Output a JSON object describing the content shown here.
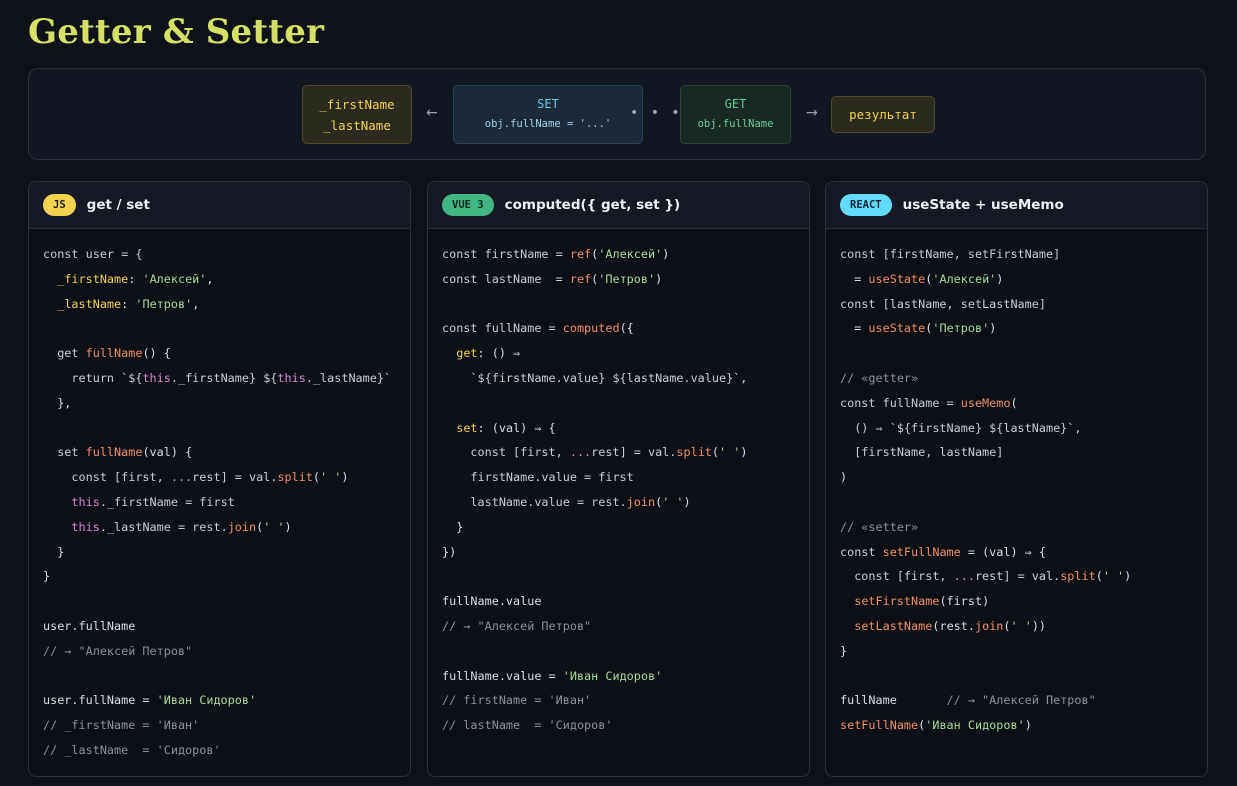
{
  "title": "Getter & Setter",
  "flow": {
    "fields_line1": "_firstName",
    "fields_line2": "_lastName",
    "arrow_left": "←",
    "set_label": "SET",
    "set_code": "obj.fullName = '...'",
    "dots": "• • •",
    "get_label": "GET",
    "get_code": "obj.fullName",
    "arrow_right": "→",
    "result_label": "результат"
  },
  "panels": [
    {
      "badge": "JS",
      "title": "get / set",
      "badge_bg": "#f2d24f",
      "badge_fg": "#1b1b10"
    },
    {
      "badge": "VUE 3",
      "title": "computed({ get, set })",
      "badge_bg": "#41b883",
      "badge_fg": "#0e2a1c"
    },
    {
      "badge": "REACT",
      "title": "useState + useMemo",
      "badge_bg": "#61dafb",
      "badge_fg": "#0b2530"
    }
  ],
  "code": {
    "js": [
      [
        [
          "const user = {",
          "kw"
        ]
      ],
      [
        [
          "  ",
          ""
        ],
        [
          "_firstName",
          "pr"
        ],
        [
          ": ",
          ""
        ],
        [
          "'Алексей'",
          "st"
        ],
        [
          ",",
          ""
        ]
      ],
      [
        [
          "  ",
          ""
        ],
        [
          "_lastName",
          "pr"
        ],
        [
          ": ",
          ""
        ],
        [
          "'Петров'",
          "st"
        ],
        [
          ",",
          ""
        ]
      ],
      [
        [
          "",
          ""
        ]
      ],
      [
        [
          "  get ",
          "kw"
        ],
        [
          "fullName",
          "fn"
        ],
        [
          "() {",
          ""
        ]
      ],
      [
        [
          "    return `${",
          "kw"
        ],
        [
          "this",
          "th"
        ],
        [
          "._firstName} ${",
          "kw"
        ],
        [
          "this",
          "th"
        ],
        [
          "._lastName}`",
          "kw"
        ]
      ],
      [
        [
          "  },",
          ""
        ]
      ],
      [
        [
          "",
          ""
        ]
      ],
      [
        [
          "  set ",
          "kw"
        ],
        [
          "fullName",
          "fn"
        ],
        [
          "(val) {",
          ""
        ]
      ],
      [
        [
          "    const [first, ",
          "kw"
        ],
        [
          "...",
          "th"
        ],
        [
          "rest] = val.",
          "kw"
        ],
        [
          "split",
          "fn"
        ],
        [
          "(",
          ""
        ],
        [
          "' '",
          "st"
        ],
        [
          ")",
          ""
        ]
      ],
      [
        [
          "    ",
          ""
        ],
        [
          "this",
          "th"
        ],
        [
          "._firstName = first",
          "kw"
        ]
      ],
      [
        [
          "    ",
          ""
        ],
        [
          "this",
          "th"
        ],
        [
          "._lastName = rest.",
          "kw"
        ],
        [
          "join",
          "fn"
        ],
        [
          "(",
          ""
        ],
        [
          "' '",
          "st"
        ],
        [
          ")",
          ""
        ]
      ],
      [
        [
          "  }",
          ""
        ]
      ],
      [
        [
          "}",
          ""
        ]
      ],
      [
        [
          "",
          ""
        ]
      ],
      [
        [
          "user.fullName",
          ""
        ]
      ],
      [
        [
          "// → \"Алексей Петров\"",
          "cm"
        ]
      ],
      [
        [
          "",
          ""
        ]
      ],
      [
        [
          "user.fullName = ",
          ""
        ],
        [
          "'Иван Сидоров'",
          "st"
        ]
      ],
      [
        [
          "// _firstName = 'Иван'",
          "cm"
        ]
      ],
      [
        [
          "// _lastName  = 'Сидоров'",
          "cm"
        ]
      ]
    ],
    "vue": [
      [
        [
          "const firstName = ",
          "kw"
        ],
        [
          "ref",
          "fn"
        ],
        [
          "(",
          ""
        ],
        [
          "'Алексей'",
          "st"
        ],
        [
          ")",
          ""
        ]
      ],
      [
        [
          "const lastName  = ",
          "kw"
        ],
        [
          "ref",
          "fn"
        ],
        [
          "(",
          ""
        ],
        [
          "'Петров'",
          "st"
        ],
        [
          ")",
          ""
        ]
      ],
      [
        [
          "",
          ""
        ]
      ],
      [
        [
          "const fullName = ",
          "kw"
        ],
        [
          "computed",
          "fn"
        ],
        [
          "({",
          ""
        ]
      ],
      [
        [
          "  ",
          ""
        ],
        [
          "get",
          "pr"
        ],
        [
          ": () ⇒",
          ""
        ]
      ],
      [
        [
          "    `${firstName.value} ${lastName.value}`,",
          "kw"
        ]
      ],
      [
        [
          "",
          ""
        ]
      ],
      [
        [
          "  ",
          ""
        ],
        [
          "set",
          "pr"
        ],
        [
          ": (val) ⇒ {",
          ""
        ]
      ],
      [
        [
          "    const [first, ",
          "kw"
        ],
        [
          "...",
          "th"
        ],
        [
          "rest] = val.",
          "kw"
        ],
        [
          "split",
          "fn"
        ],
        [
          "(",
          ""
        ],
        [
          "' '",
          "st"
        ],
        [
          ")",
          ""
        ]
      ],
      [
        [
          "    firstName.value = first",
          "kw"
        ]
      ],
      [
        [
          "    lastName.value = rest.",
          "kw"
        ],
        [
          "join",
          "fn"
        ],
        [
          "(",
          ""
        ],
        [
          "' '",
          "st"
        ],
        [
          ")",
          ""
        ]
      ],
      [
        [
          "  }",
          ""
        ]
      ],
      [
        [
          "})",
          ""
        ]
      ],
      [
        [
          "",
          ""
        ]
      ],
      [
        [
          "fullName.value",
          ""
        ]
      ],
      [
        [
          "// → \"Алексей Петров\"",
          "cm"
        ]
      ],
      [
        [
          "",
          ""
        ]
      ],
      [
        [
          "fullName.value = ",
          ""
        ],
        [
          "'Иван Сидоров'",
          "st"
        ]
      ],
      [
        [
          "// firstName = 'Иван'",
          "cm"
        ]
      ],
      [
        [
          "// lastName  = 'Сидоров'",
          "cm"
        ]
      ]
    ],
    "react": [
      [
        [
          "const [firstName, setFirstName]",
          "kw"
        ]
      ],
      [
        [
          "  = ",
          ""
        ],
        [
          "useState",
          "fn"
        ],
        [
          "(",
          ""
        ],
        [
          "'Алексей'",
          "st"
        ],
        [
          ")",
          ""
        ]
      ],
      [
        [
          "const [lastName, setLastName]",
          "kw"
        ]
      ],
      [
        [
          "  = ",
          ""
        ],
        [
          "useState",
          "fn"
        ],
        [
          "(",
          ""
        ],
        [
          "'Петров'",
          "st"
        ],
        [
          ")",
          ""
        ]
      ],
      [
        [
          "",
          ""
        ]
      ],
      [
        [
          "// «getter»",
          "cm"
        ]
      ],
      [
        [
          "const fullName = ",
          "kw"
        ],
        [
          "useMemo",
          "fn"
        ],
        [
          "(",
          ""
        ]
      ],
      [
        [
          "  () ⇒ `${firstName} ${lastName}`,",
          "kw"
        ]
      ],
      [
        [
          "  [firstName, lastName]",
          "kw"
        ]
      ],
      [
        [
          ")",
          ""
        ]
      ],
      [
        [
          "",
          ""
        ]
      ],
      [
        [
          "// «setter»",
          "cm"
        ]
      ],
      [
        [
          "const ",
          "kw"
        ],
        [
          "setFullName",
          "fn"
        ],
        [
          " = (val) ⇒ {",
          ""
        ]
      ],
      [
        [
          "  const [first, ",
          "kw"
        ],
        [
          "...",
          "th"
        ],
        [
          "rest] = val.",
          "kw"
        ],
        [
          "split",
          "fn"
        ],
        [
          "(",
          ""
        ],
        [
          "' '",
          "st"
        ],
        [
          ")",
          ""
        ]
      ],
      [
        [
          "  ",
          ""
        ],
        [
          "setFirstName",
          "fn"
        ],
        [
          "(first)",
          ""
        ]
      ],
      [
        [
          "  ",
          ""
        ],
        [
          "setLastName",
          "fn"
        ],
        [
          "(rest.",
          ""
        ],
        [
          "join",
          "fn"
        ],
        [
          "(",
          ""
        ],
        [
          "' '",
          "st"
        ],
        [
          "))",
          ""
        ]
      ],
      [
        [
          "}",
          ""
        ]
      ],
      [
        [
          "",
          ""
        ]
      ],
      [
        [
          "fullName       ",
          ""
        ],
        [
          "// → \"Алексей Петров\"",
          "cm"
        ]
      ],
      [
        [
          "setFullName",
          "fn"
        ],
        [
          "(",
          ""
        ],
        [
          "'Иван Сидоров'",
          "st"
        ],
        [
          ")",
          ""
        ]
      ]
    ]
  }
}
